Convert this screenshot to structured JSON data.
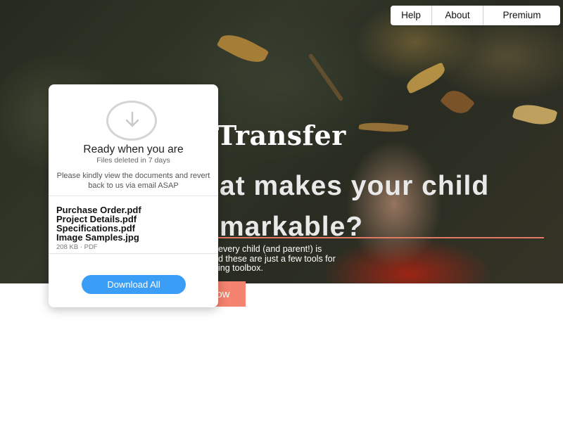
{
  "nav": {
    "items": [
      {
        "label": "Help"
      },
      {
        "label": "About"
      },
      {
        "label": "Premium"
      }
    ]
  },
  "hero": {
    "title": "Transfer",
    "heading_line1": "at makes your child",
    "heading_line2": "markable?",
    "body_line1": "every child (and parent!) is",
    "body_line2": "d these are just a few tools for",
    "body_line3": "ing toolbox.",
    "cta_label": "low"
  },
  "card": {
    "icon": "download-arrow-icon",
    "title": "Ready when you are",
    "subtitle": "Files deleted in 7 days",
    "message": "Please kindly view the documents and revert back to us via email ASAP",
    "files": [
      {
        "name": "Purchase Order.pdf"
      },
      {
        "name": "Project Details.pdf"
      },
      {
        "name": "Specifications.pdf"
      },
      {
        "name": "Image Samples.jpg"
      }
    ],
    "meta": "208 KB ·  PDF",
    "download_label": "Download All"
  },
  "colors": {
    "accent_blue": "#3a9ef7",
    "cta_salmon": "#f4836f",
    "underline": "#e07a63"
  }
}
